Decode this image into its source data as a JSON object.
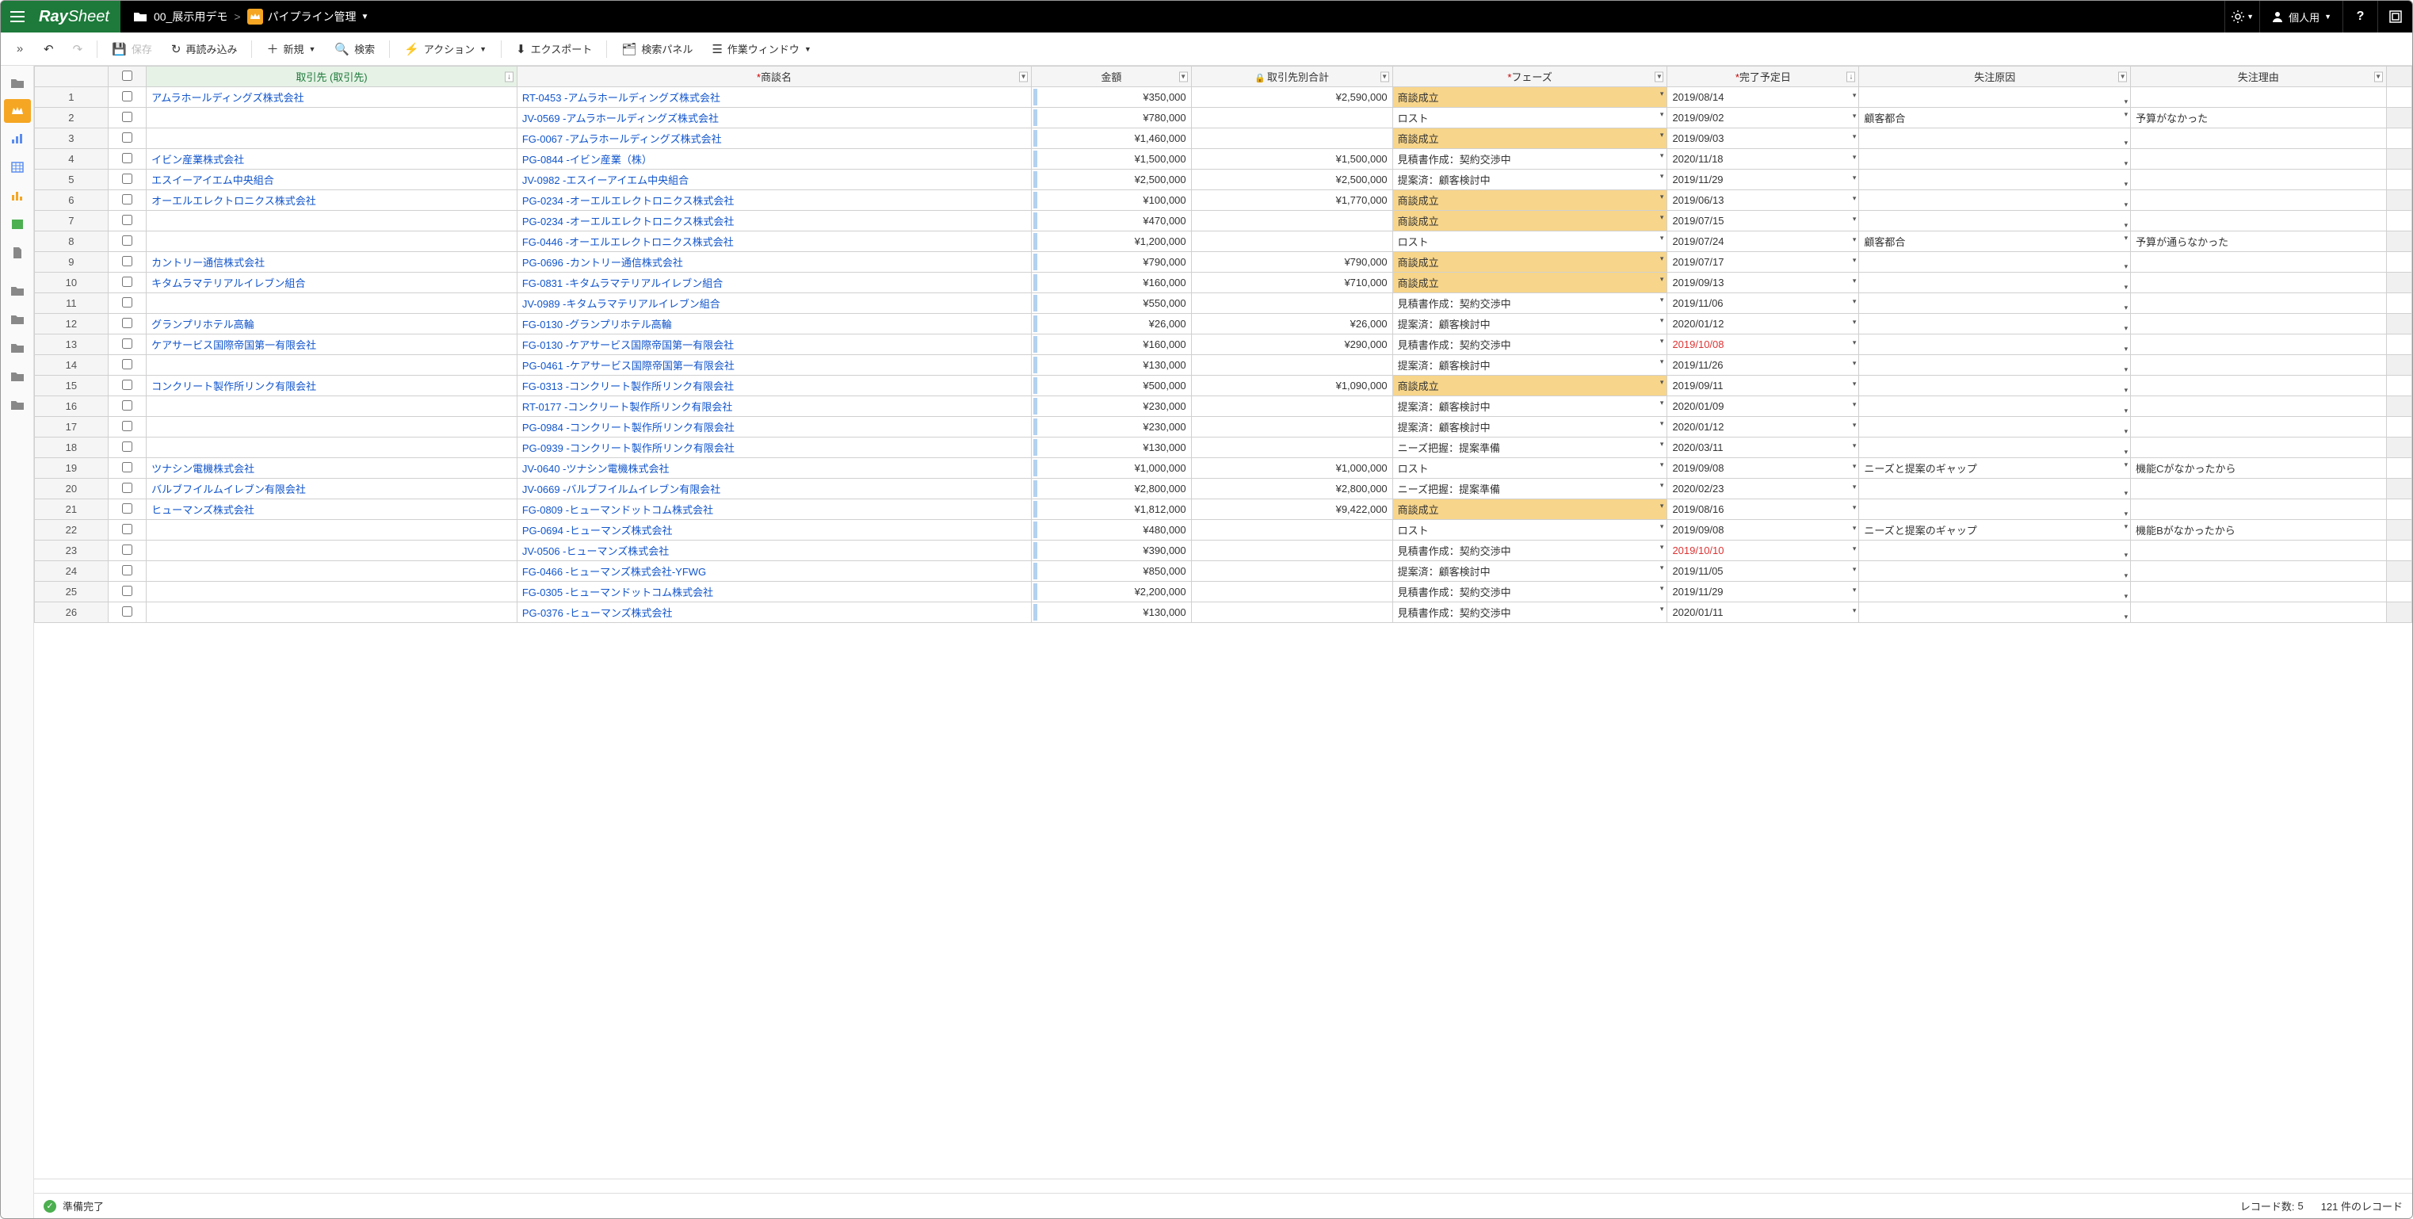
{
  "topbar": {
    "logo_bold": "Ray",
    "logo_light": "Sheet",
    "breadcrumb_folder": "00_展示用デモ",
    "breadcrumb_sep": ">",
    "breadcrumb_current": "パイプライン管理",
    "user_label": "個人用"
  },
  "toolbar": {
    "save": "保存",
    "reload": "再読み込み",
    "new": "新規",
    "search": "検索",
    "action": "アクション",
    "export": "エクスポート",
    "search_panel": "検索パネル",
    "work_window": "作業ウィンドウ"
  },
  "columns": {
    "account": "取引先 (取引先)",
    "opportunity": "商談名",
    "amount": "金額",
    "account_total": "取引先別合計",
    "phase": "フェーズ",
    "close_date": "完了予定日",
    "lost_reason": "失注原因",
    "lost_detail": "失注理由"
  },
  "rows": [
    {
      "n": 1,
      "account": "アムラホールディングズ株式会社",
      "opp": "RT-0453 -アムラホールディングズ株式会社",
      "amount": "¥350,000",
      "total": "¥2,590,000",
      "phase": "商談成立",
      "phase_hl": true,
      "date": "2019/08/14",
      "reason": "",
      "detail": ""
    },
    {
      "n": 2,
      "account": "",
      "opp": "JV-0569 -アムラホールディングズ株式会社",
      "amount": "¥780,000",
      "total": "",
      "phase": "ロスト",
      "phase_hl": false,
      "date": "2019/09/02",
      "reason": "顧客都合",
      "detail": "予算がなかった"
    },
    {
      "n": 3,
      "account": "",
      "opp": "FG-0067 -アムラホールディングズ株式会社",
      "amount": "¥1,460,000",
      "total": "",
      "phase": "商談成立",
      "phase_hl": true,
      "date": "2019/09/03",
      "reason": "",
      "detail": ""
    },
    {
      "n": 4,
      "account": "イビン産業株式会社",
      "opp": "PG-0844 -イビン産業（株）",
      "amount": "¥1,500,000",
      "total": "¥1,500,000",
      "phase": "見積書作成：契約交渉中",
      "phase_hl": false,
      "date": "2020/11/18",
      "reason": "",
      "detail": ""
    },
    {
      "n": 5,
      "account": "エスイーアイエム中央組合",
      "opp": "JV-0982 -エスイーアイエム中央組合",
      "amount": "¥2,500,000",
      "total": "¥2,500,000",
      "phase": "提案済：顧客検討中",
      "phase_hl": false,
      "date": "2019/11/29",
      "reason": "",
      "detail": ""
    },
    {
      "n": 6,
      "account": "オーエルエレクトロニクス株式会社",
      "opp": "PG-0234 -オーエルエレクトロニクス株式会社",
      "amount": "¥100,000",
      "total": "¥1,770,000",
      "phase": "商談成立",
      "phase_hl": true,
      "date": "2019/06/13",
      "reason": "",
      "detail": ""
    },
    {
      "n": 7,
      "account": "",
      "opp": "PG-0234 -オーエルエレクトロニクス株式会社",
      "amount": "¥470,000",
      "total": "",
      "phase": "商談成立",
      "phase_hl": true,
      "date": "2019/07/15",
      "reason": "",
      "detail": ""
    },
    {
      "n": 8,
      "account": "",
      "opp": "FG-0446 -オーエルエレクトロニクス株式会社",
      "amount": "¥1,200,000",
      "total": "",
      "phase": "ロスト",
      "phase_hl": false,
      "date": "2019/07/24",
      "reason": "顧客都合",
      "detail": "予算が通らなかった"
    },
    {
      "n": 9,
      "account": "カントリー通信株式会社",
      "opp": "PG-0696 -カントリー通信株式会社",
      "amount": "¥790,000",
      "total": "¥790,000",
      "phase": "商談成立",
      "phase_hl": true,
      "date": "2019/07/17",
      "reason": "",
      "detail": ""
    },
    {
      "n": 10,
      "account": "キタムラマテリアルイレブン組合",
      "opp": "FG-0831 -キタムラマテリアルイレブン組合",
      "amount": "¥160,000",
      "total": "¥710,000",
      "phase": "商談成立",
      "phase_hl": true,
      "date": "2019/09/13",
      "reason": "",
      "detail": ""
    },
    {
      "n": 11,
      "account": "",
      "opp": "JV-0989 -キタムラマテリアルイレブン組合",
      "amount": "¥550,000",
      "total": "",
      "phase": "見積書作成：契約交渉中",
      "phase_hl": false,
      "date": "2019/11/06",
      "reason": "",
      "detail": ""
    },
    {
      "n": 12,
      "account": "グランプリホテル高輪",
      "opp": "FG-0130 -グランプリホテル高輪",
      "amount": "¥26,000",
      "total": "¥26,000",
      "phase": "提案済：顧客検討中",
      "phase_hl": false,
      "date": "2020/01/12",
      "reason": "",
      "detail": ""
    },
    {
      "n": 13,
      "account": "ケアサービス国際帝国第一有限会社",
      "opp": "FG-0130 -ケアサービス国際帝国第一有限会社",
      "amount": "¥160,000",
      "total": "¥290,000",
      "phase": "見積書作成：契約交渉中",
      "phase_hl": false,
      "date": "2019/10/08",
      "date_red": true,
      "reason": "",
      "detail": ""
    },
    {
      "n": 14,
      "account": "",
      "opp": "PG-0461 -ケアサービス国際帝国第一有限会社",
      "amount": "¥130,000",
      "total": "",
      "phase": "提案済：顧客検討中",
      "phase_hl": false,
      "date": "2019/11/26",
      "reason": "",
      "detail": ""
    },
    {
      "n": 15,
      "account": "コンクリート製作所リンク有限会社",
      "opp": "FG-0313 -コンクリート製作所リンク有限会社",
      "amount": "¥500,000",
      "total": "¥1,090,000",
      "phase": "商談成立",
      "phase_hl": true,
      "date": "2019/09/11",
      "reason": "",
      "detail": ""
    },
    {
      "n": 16,
      "account": "",
      "opp": "RT-0177 -コンクリート製作所リンク有限会社",
      "amount": "¥230,000",
      "total": "",
      "phase": "提案済：顧客検討中",
      "phase_hl": false,
      "date": "2020/01/09",
      "reason": "",
      "detail": ""
    },
    {
      "n": 17,
      "account": "",
      "opp": "PG-0984 -コンクリート製作所リンク有限会社",
      "amount": "¥230,000",
      "total": "",
      "phase": "提案済：顧客検討中",
      "phase_hl": false,
      "date": "2020/01/12",
      "reason": "",
      "detail": ""
    },
    {
      "n": 18,
      "account": "",
      "opp": "PG-0939 -コンクリート製作所リンク有限会社",
      "amount": "¥130,000",
      "total": "",
      "phase": "ニーズ把握：提案準備",
      "phase_hl": false,
      "date": "2020/03/11",
      "reason": "",
      "detail": ""
    },
    {
      "n": 19,
      "account": "ツナシン電機株式会社",
      "opp": "JV-0640 -ツナシン電機株式会社",
      "amount": "¥1,000,000",
      "total": "¥1,000,000",
      "phase": "ロスト",
      "phase_hl": false,
      "date": "2019/09/08",
      "reason": "ニーズと提案のギャップ",
      "detail": "機能Cがなかったから"
    },
    {
      "n": 20,
      "account": "バルブフイルムイレブン有限会社",
      "opp": "JV-0669 -バルブフイルムイレブン有限会社",
      "amount": "¥2,800,000",
      "total": "¥2,800,000",
      "phase": "ニーズ把握：提案準備",
      "phase_hl": false,
      "date": "2020/02/23",
      "reason": "",
      "detail": ""
    },
    {
      "n": 21,
      "account": "ヒューマンズ株式会社",
      "opp": "FG-0809 -ヒューマンドットコム株式会社",
      "amount": "¥1,812,000",
      "total": "¥9,422,000",
      "phase": "商談成立",
      "phase_hl": true,
      "date": "2019/08/16",
      "reason": "",
      "detail": ""
    },
    {
      "n": 22,
      "account": "",
      "opp": "PG-0694 -ヒューマンズ株式会社",
      "amount": "¥480,000",
      "total": "",
      "phase": "ロスト",
      "phase_hl": false,
      "date": "2019/09/08",
      "reason": "ニーズと提案のギャップ",
      "detail": "機能Bがなかったから"
    },
    {
      "n": 23,
      "account": "",
      "opp": "JV-0506 -ヒューマンズ株式会社",
      "amount": "¥390,000",
      "total": "",
      "phase": "見積書作成：契約交渉中",
      "phase_hl": false,
      "date": "2019/10/10",
      "date_red": true,
      "reason": "",
      "detail": ""
    },
    {
      "n": 24,
      "account": "",
      "opp": "FG-0466 -ヒューマンズ株式会社-YFWG",
      "amount": "¥850,000",
      "total": "",
      "phase": "提案済：顧客検討中",
      "phase_hl": false,
      "date": "2019/11/05",
      "reason": "",
      "detail": ""
    },
    {
      "n": 25,
      "account": "",
      "opp": "FG-0305 -ヒューマンドットコム株式会社",
      "amount": "¥2,200,000",
      "total": "",
      "phase": "見積書作成：契約交渉中",
      "phase_hl": false,
      "date": "2019/11/29",
      "reason": "",
      "detail": ""
    },
    {
      "n": 26,
      "account": "",
      "opp": "PG-0376 -ヒューマンズ株式会社",
      "amount": "¥130,000",
      "total": "",
      "phase": "見積書作成：契約交渉中",
      "phase_hl": false,
      "date": "2020/01/11",
      "reason": "",
      "detail": ""
    }
  ],
  "status": {
    "ready": "準備完了",
    "record_count_label": "レコード数:",
    "record_count": "5",
    "total_records": "121 件のレコード"
  }
}
